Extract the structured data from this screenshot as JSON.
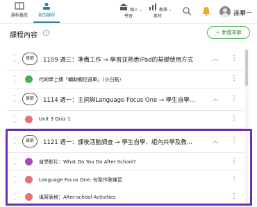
{
  "nav": {
    "items": [
      {
        "label": "課程播放"
      },
      {
        "label": "我的課程"
      },
      {
        "label": "個人學習"
      },
      {
        "label": "教學素材"
      }
    ],
    "user_name": "孫華一"
  },
  "header": {
    "title": "課程內容",
    "new_unit_label": "＋ 新建章節"
  },
  "units": [
    {
      "badge": "章節",
      "title": "1109 週三：準備工作 → 學習並熟悉iPad的基礎使用方式",
      "items": [
        {
          "label": "代同學上傳「輔助觸控選單」（小白點）",
          "color": "#4caf50"
        }
      ]
    },
    {
      "badge": "章節",
      "title": "1114 週一：主詞與Language Focus One → 學生自學...",
      "items": [
        {
          "label": "Unit 3 Quiz 1",
          "color": "#e57373"
        }
      ]
    },
    {
      "badge": "章節",
      "title": "1121 週一：課後活動調查 → 學生自學、組內共學及教...",
      "items": [
        {
          "label": "自學影片：What Do You Do After School?",
          "color": "#ab47bc"
        },
        {
          "label": "Language Focus One: 句型作答練習",
          "color": "#e57373"
        },
        {
          "label": "填寫表格：After-school Activities",
          "color": "#e57373"
        }
      ]
    }
  ],
  "colors": {
    "accent": "#2a7fae",
    "highlight": "#6a2db8",
    "new_button": "#4caf50"
  }
}
